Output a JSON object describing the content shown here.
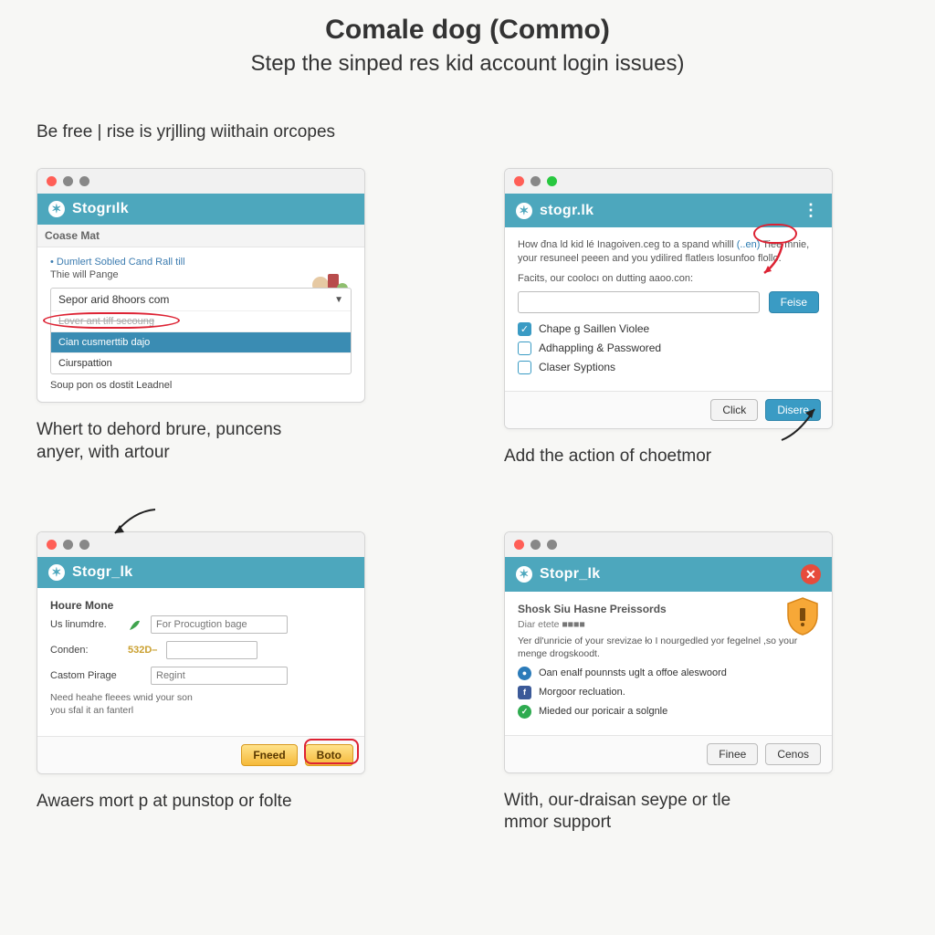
{
  "page": {
    "title": "Comale dog (Commo)",
    "subtitle": "Step the sinped res kid account login issues)",
    "intro": "Be free | rise is yrjlling wiithain orcopes"
  },
  "colors": {
    "accent": "#4da7bd",
    "primary_btn": "#3a9bc4",
    "gold": "#f5b93a",
    "red": "#e74c3c"
  },
  "panel1": {
    "brand": "Stogrılk",
    "section": "Coase Mat",
    "bullet": "• Dumlert Sobled Cand Rall till",
    "note": "Thie will Pange",
    "select_value": "Sepor arid 8hoors com",
    "options": [
      "Lover ant tiff secoung",
      "Cian cusmerttib dajo",
      "Ciurspattion"
    ],
    "footer_text": "Soup pon os dostit Leadnel",
    "caption": "Whert to dehord brure, puncens anyer, with artour"
  },
  "panel2": {
    "brand": "stogr.lk",
    "desc_pre": "How đna ld kid lé Inagoiven.ceg to a spand whilll ",
    "desc_link": "(..en)",
    "desc_post": " Tiee mnie, your resuneel peeen and you ydilired flatleıs losunfoo flollo.",
    "line2": "Facits, our coolocı on dutting aaoo.con:",
    "btn_primary": "Feise",
    "checks": [
      {
        "label": "Chape g Saillen Violee",
        "checked": true
      },
      {
        "label": "Adhappling & Passwored",
        "checked": false
      },
      {
        "label": "Claser Syptions",
        "checked": false
      }
    ],
    "footer_cancel": "Click",
    "footer_ok": "Disere",
    "caption": "Add the action of choetmor"
  },
  "panel3": {
    "brand": "Stogr_lk",
    "heading": "Houre Mone",
    "rows": [
      {
        "label": "Us linumdre.",
        "value": "",
        "placeholder": "For Procugtion bage",
        "icon": "leaf"
      },
      {
        "label": "Conden:",
        "value": "",
        "badge": "532D–",
        "placeholder": ""
      },
      {
        "label": "Castom Pirage",
        "value": "",
        "placeholder": "Regint"
      }
    ],
    "hint": "Need heahe fleees wnid your son you sfal it an fanterl",
    "btn_left": "Fneed",
    "btn_right": "Boto",
    "caption": "Awaers mort p at punstop or folte"
  },
  "panel4": {
    "brand": "Stopr_lk",
    "heading": "Shosk Siu Hasne Preissords",
    "sub": "Diar etete   ■■■■",
    "para": "Yer dl'unricie of your srevizae ło I nourgedled yor fegelnel ,so your menge drogskoodt.",
    "bullets": [
      {
        "icon": "blue",
        "text": "Oan enalf pounnsts uglt a offoe aleswoord"
      },
      {
        "icon": "fb",
        "text": "Morgoor recluation."
      },
      {
        "icon": "green",
        "text": "Mieded our poricair a solgnle"
      }
    ],
    "btn_left": "Finee",
    "btn_right": "Cenos",
    "caption": "With, our-draisan seype or tle mmor support"
  }
}
